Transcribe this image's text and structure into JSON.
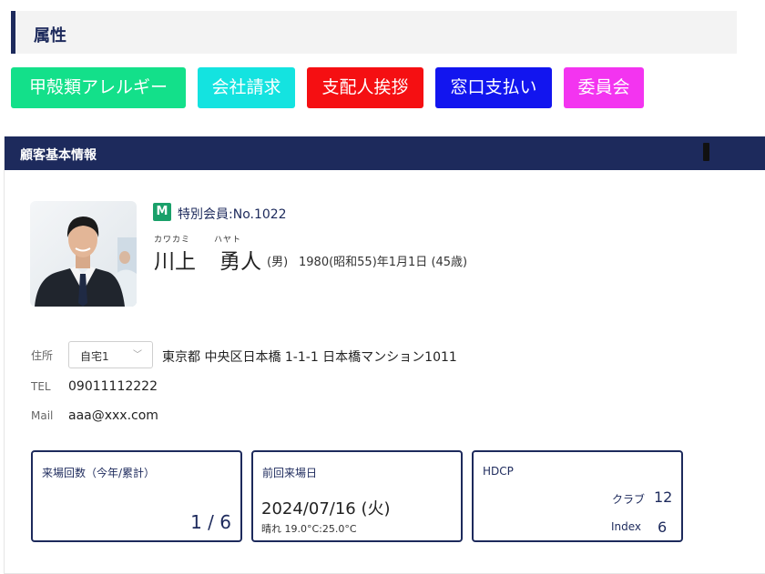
{
  "attributes": {
    "title": "属性",
    "tags": [
      {
        "label": "甲殻類アレルギー",
        "color": "#13e08a"
      },
      {
        "label": "会社請求",
        "color": "#14e3e0"
      },
      {
        "label": "支配人挨拶",
        "color": "#f50f12"
      },
      {
        "label": "窓口支払い",
        "color": "#1215ef"
      },
      {
        "label": "委員会",
        "color": "#f334f0"
      }
    ]
  },
  "customer": {
    "section_title": "顧客基本情報",
    "badge": "M",
    "member_label": "特別会員:No.1022",
    "furigana_family": "カワカミ",
    "furigana_given": "ハヤト",
    "family_name": "川上",
    "given_name": "勇人",
    "gender": "(男)",
    "birth": "1980(昭和55)年1月1日 (45歳)",
    "address_label": "住所",
    "address_type": "自宅1",
    "address": "東京都 中央区日本橋 1-1-1 日本橋マンション1011",
    "tel_label": "TEL",
    "tel": "09011112222",
    "mail_label": "Mail",
    "mail": "aaa@xxx.com"
  },
  "stats": {
    "visits_title": "来場回数（今年/累計）",
    "visits_value": "1 / 6",
    "last_visit_title": "前回来場日",
    "last_visit_date": "2024/07/16 (火)",
    "last_visit_weather": "晴れ 19.0°C:25.0°C",
    "hdcp_title": "HDCP",
    "club_label": "クラブ",
    "club_value": "12",
    "index_label": "Index",
    "index_value": "6"
  },
  "colors": {
    "navy": "#1d2a5c",
    "badge_green": "#1aa06a"
  }
}
